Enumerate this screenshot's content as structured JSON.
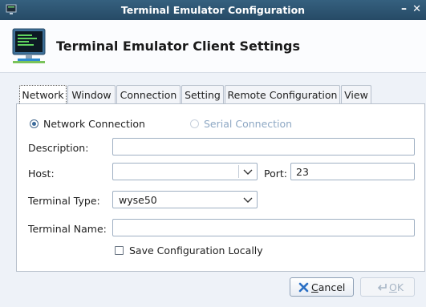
{
  "window": {
    "title": "Terminal Emulator Configuration",
    "minimize": "–",
    "close": "✕"
  },
  "header": {
    "title": "Terminal Emulator Client Settings",
    "logo": "terminal-monitor-icon"
  },
  "tabs": [
    {
      "label": "Network",
      "active": true
    },
    {
      "label": "Window",
      "active": false
    },
    {
      "label": "Connection",
      "active": false
    },
    {
      "label": "Setting",
      "active": false
    },
    {
      "label": "Remote Configuration",
      "active": false
    },
    {
      "label": "View",
      "active": false
    }
  ],
  "connection_type": {
    "network": {
      "label": "Network Connection",
      "checked": true
    },
    "serial": {
      "label": "Serial Connection",
      "checked": false,
      "enabled": false
    }
  },
  "fields": {
    "description": {
      "label": "Description:",
      "value": ""
    },
    "host": {
      "label": "Host:",
      "value": ""
    },
    "port": {
      "label": "Port:",
      "value": "23"
    },
    "terminal_type": {
      "label": "Terminal Type:",
      "value": "wyse50"
    },
    "terminal_name": {
      "label": "Terminal Name:",
      "value": ""
    }
  },
  "save_locally": {
    "label": "Save Configuration Locally",
    "checked": false
  },
  "buttons": {
    "cancel": {
      "mnemonic": "C",
      "rest": "ancel"
    },
    "ok": {
      "mnemonic": "O",
      "rest": "K",
      "enabled": false
    }
  },
  "colors": {
    "titlebar": "#2d5573",
    "accent": "#3b6b9c",
    "disabled_text": "#8ea8c4"
  }
}
